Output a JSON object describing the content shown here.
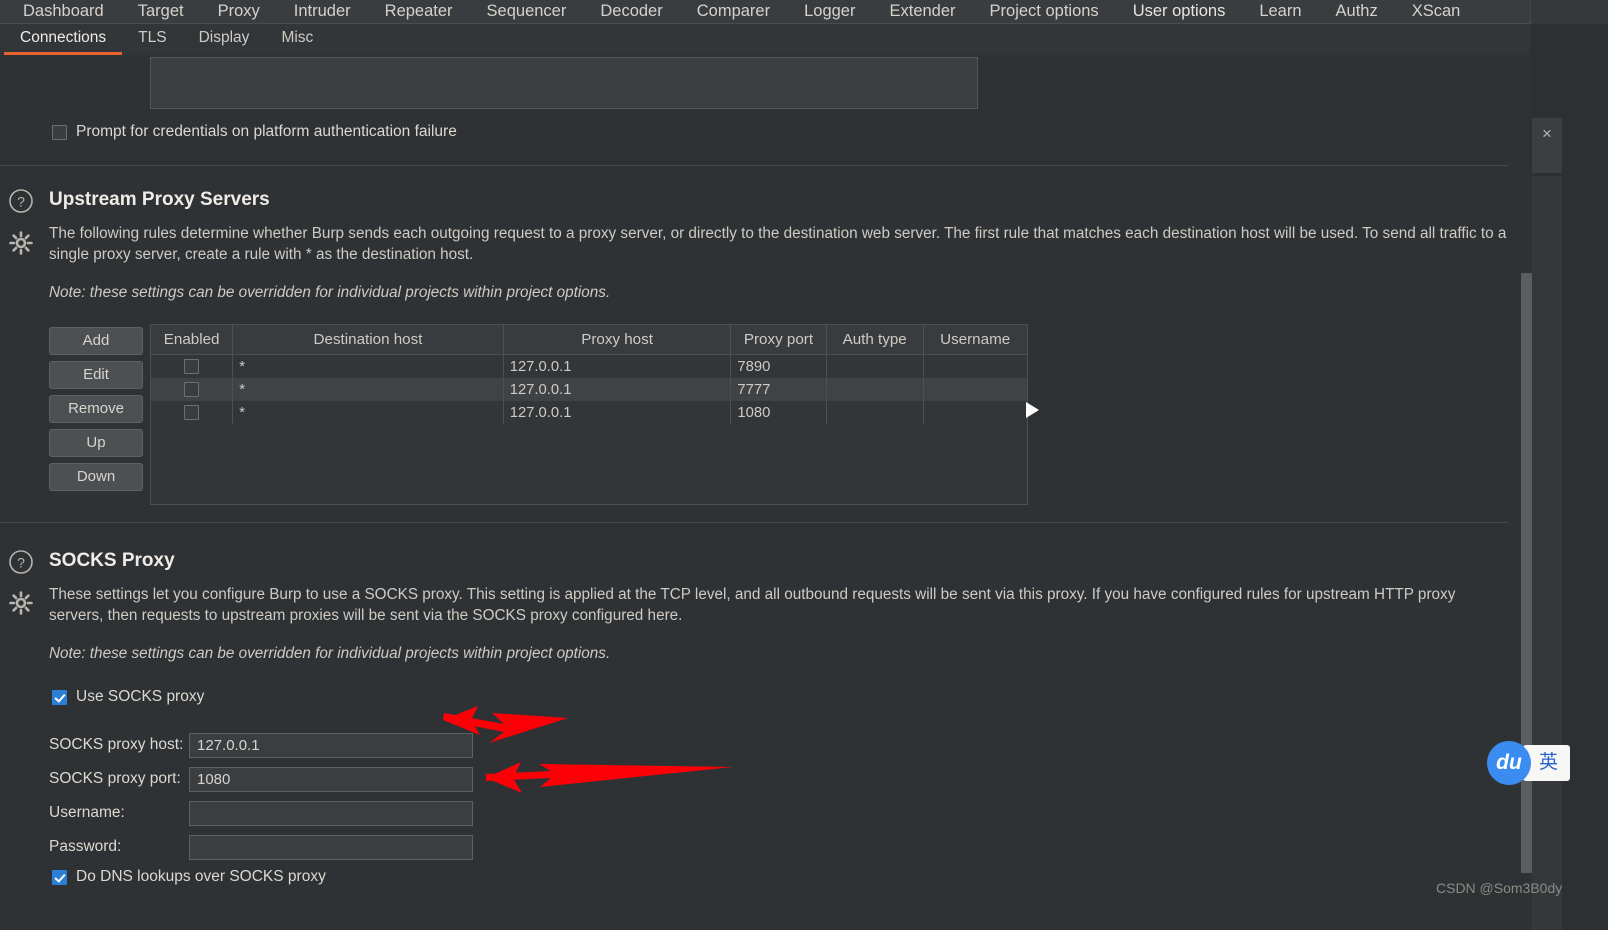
{
  "window": {
    "close_label": "×"
  },
  "main_tabs": [
    {
      "label": "Dashboard",
      "active": false
    },
    {
      "label": "Target",
      "active": false
    },
    {
      "label": "Proxy",
      "active": false
    },
    {
      "label": "Intruder",
      "active": false
    },
    {
      "label": "Repeater",
      "active": false
    },
    {
      "label": "Sequencer",
      "active": false
    },
    {
      "label": "Decoder",
      "active": false
    },
    {
      "label": "Comparer",
      "active": false
    },
    {
      "label": "Logger",
      "active": false
    },
    {
      "label": "Extender",
      "active": false
    },
    {
      "label": "Project options",
      "active": false
    },
    {
      "label": "User options",
      "active": true
    },
    {
      "label": "Learn",
      "active": false
    },
    {
      "label": "Authz",
      "active": false
    },
    {
      "label": "XScan",
      "active": false
    }
  ],
  "sub_tabs": [
    {
      "label": "Connections",
      "active": true
    },
    {
      "label": "TLS",
      "active": false
    },
    {
      "label": "Display",
      "active": false
    },
    {
      "label": "Misc",
      "active": false
    }
  ],
  "platform_auth": {
    "prompt_checkbox_label": "Prompt for credentials on platform authentication failure",
    "prompt_checked": false
  },
  "upstream": {
    "title": "Upstream Proxy Servers",
    "description": "The following rules determine whether Burp sends each outgoing request to a proxy server, or directly to the destination web server. The first rule that matches each destination host will be used. To send all traffic to a single proxy server, create a rule with * as the destination host.",
    "note": "Note: these settings can be overridden for individual projects within project options.",
    "buttons": [
      {
        "label": "Add"
      },
      {
        "label": "Edit"
      },
      {
        "label": "Remove"
      },
      {
        "label": "Up"
      },
      {
        "label": "Down"
      }
    ],
    "table": {
      "columns": [
        "Enabled",
        "Destination host",
        "Proxy host",
        "Proxy port",
        "Auth type",
        "Username"
      ],
      "rows": [
        {
          "enabled": false,
          "destination_host": "*",
          "proxy_host": "127.0.0.1",
          "proxy_port": "7890",
          "auth_type": "",
          "username": ""
        },
        {
          "enabled": false,
          "destination_host": "*",
          "proxy_host": "127.0.0.1",
          "proxy_port": "7777",
          "auth_type": "",
          "username": ""
        },
        {
          "enabled": false,
          "destination_host": "*",
          "proxy_host": "127.0.0.1",
          "proxy_port": "1080",
          "auth_type": "",
          "username": ""
        }
      ]
    }
  },
  "socks": {
    "title": "SOCKS Proxy",
    "description": "These settings let you configure Burp to use a SOCKS proxy. This setting is applied at the TCP level, and all outbound requests will be sent via this proxy. If you have configured rules for upstream HTTP proxy servers, then requests to upstream proxies will be sent via the SOCKS proxy configured here.",
    "note": "Note: these settings can be overridden for individual projects within project options.",
    "use_socks_label": "Use SOCKS proxy",
    "use_socks_checked": true,
    "fields": [
      {
        "label": "SOCKS proxy host:",
        "value": "127.0.0.1",
        "placeholder": ""
      },
      {
        "label": "SOCKS proxy port:",
        "value": "1080",
        "placeholder": ""
      },
      {
        "label": "Username:",
        "value": "",
        "placeholder": ""
      },
      {
        "label": "Password:",
        "value": "",
        "placeholder": ""
      }
    ],
    "dns_label": "Do DNS lookups over SOCKS proxy",
    "dns_checked": true
  },
  "ime": {
    "logo_text": "du",
    "mode_text": "英"
  },
  "watermark": "CSDN @Som3B0dy",
  "colors": {
    "accent": "#e8622c",
    "background": "#2f3234",
    "checkbox_checked": "#2b7fd4",
    "annotation_arrow": "#fb0007",
    "ime_blue": "#3b8cf0"
  }
}
